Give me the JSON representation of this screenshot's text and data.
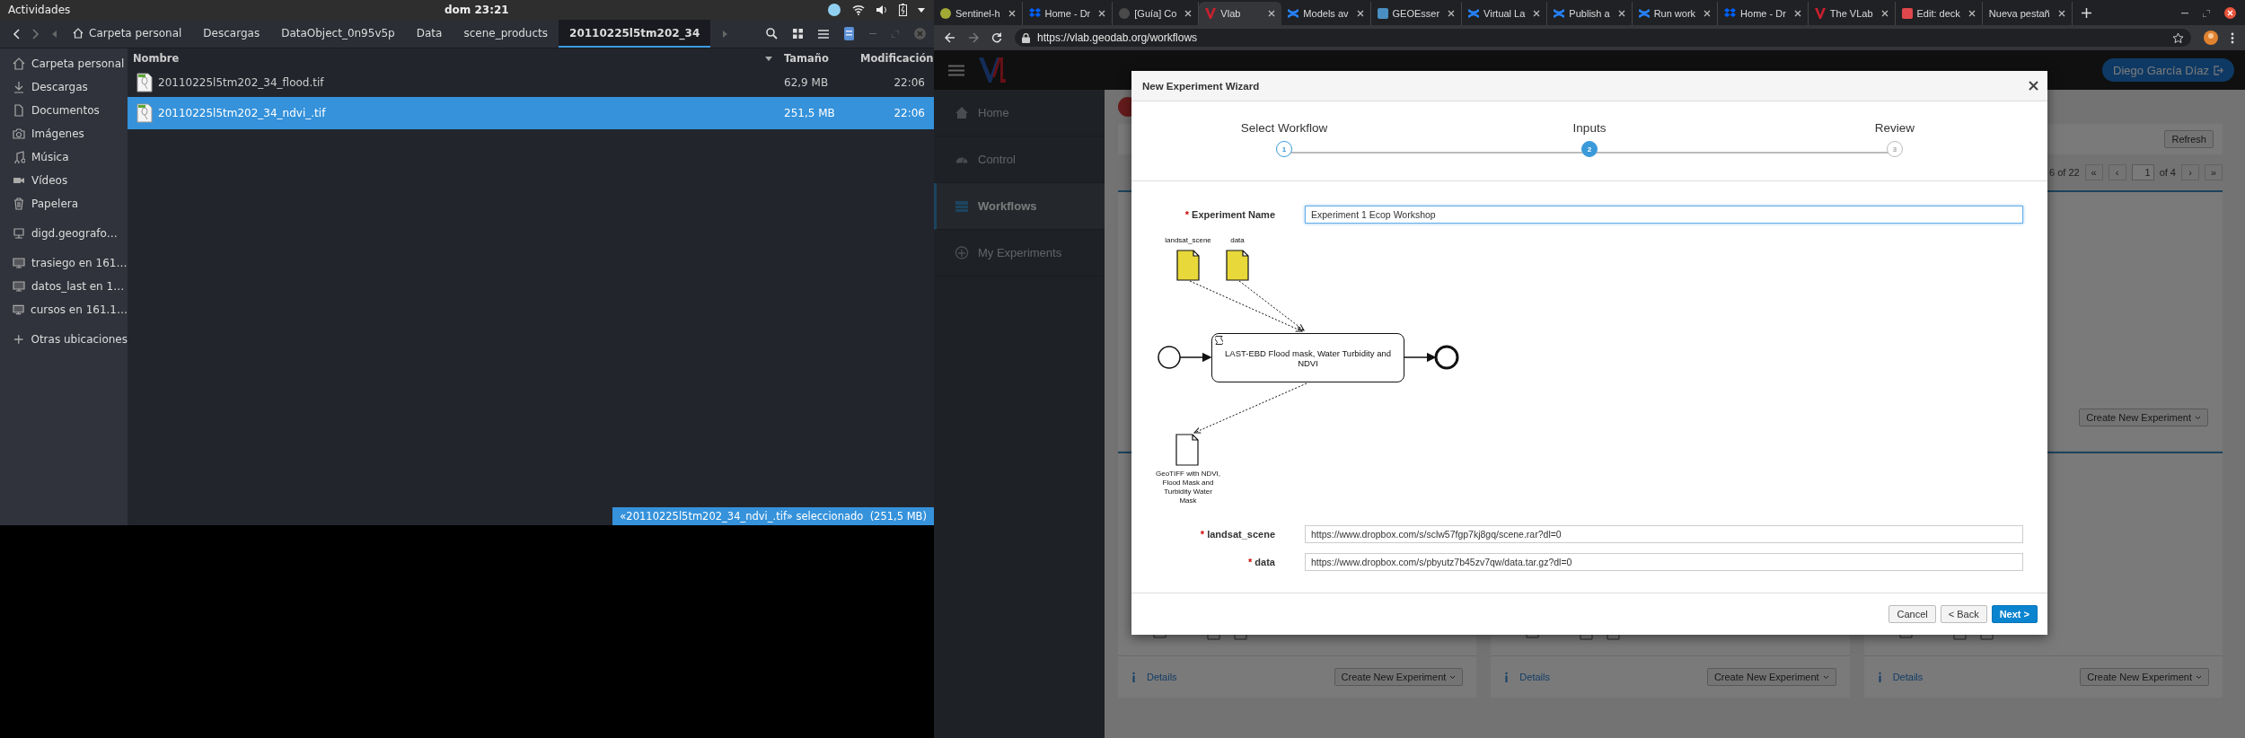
{
  "top_bar": {
    "activities": "Actividades",
    "clock": "dom 23:21"
  },
  "files": {
    "path": [
      {
        "label": "Carpeta personal",
        "kind": "home",
        "selected": false
      },
      {
        "label": "Descargas",
        "kind": "plain",
        "selected": false
      },
      {
        "label": "DataObject_0n95v5p",
        "kind": "plain",
        "selected": false
      },
      {
        "label": "Data",
        "kind": "plain",
        "selected": false
      },
      {
        "label": "scene_products",
        "kind": "plain",
        "selected": false
      },
      {
        "label": "20110225l5tm202_34",
        "kind": "plain",
        "selected": true
      }
    ],
    "sidebar_groups": [
      {
        "items": [
          {
            "label": "Carpeta personal",
            "kind": "home"
          },
          {
            "label": "Descargas",
            "kind": "download"
          },
          {
            "label": "Documentos",
            "kind": "document"
          },
          {
            "label": "Imágenes",
            "kind": "camera"
          },
          {
            "label": "Música",
            "kind": "music"
          },
          {
            "label": "Vídeos",
            "kind": "video"
          },
          {
            "label": "Papelera",
            "kind": "trash"
          }
        ]
      },
      {
        "items": [
          {
            "label": "digd.geografo…",
            "kind": "drive"
          }
        ]
      },
      {
        "items": [
          {
            "label": "trasiego en 161…",
            "kind": "network"
          },
          {
            "label": "datos_last en 1…",
            "kind": "network"
          },
          {
            "label": "cursos en 161.1…",
            "kind": "network"
          }
        ]
      },
      {
        "items": [
          {
            "label": "Otras ubicaciones",
            "kind": "add"
          }
        ]
      }
    ],
    "columns": [
      "Nombre",
      "Tamaño",
      "Modificación"
    ],
    "rows": [
      {
        "name": "20110225l5tm202_34_flood.tif",
        "size": "62,9 MB",
        "modified": "22:06",
        "selected": false
      },
      {
        "name": "20110225l5tm202_34_ndvi_.tif",
        "size": "251,5 MB",
        "modified": "22:06",
        "selected": true
      }
    ],
    "status": "«20110225l5tm202_34_ndvi_.tif» seleccionado  (251,5 MB)"
  },
  "browser": {
    "tabs": [
      {
        "title": "Sentinel-h",
        "kind": "dot",
        "color": "#a3a935",
        "selected": false
      },
      {
        "title": "Home - Dr",
        "kind": "box",
        "color": "#0061fe",
        "selected": false
      },
      {
        "title": "[Guía] Co",
        "kind": "dot",
        "color": "#4a4a4a",
        "selected": false
      },
      {
        "title": "Vlab",
        "kind": "vl",
        "color": "#c8202f",
        "selected": true
      },
      {
        "title": "Models av",
        "kind": "x",
        "color": "#2684ff",
        "selected": false
      },
      {
        "title": "GEOEsser",
        "kind": "square",
        "color": "#4a8fc1",
        "selected": false
      },
      {
        "title": "Virtual La",
        "kind": "x",
        "color": "#2684ff",
        "selected": false
      },
      {
        "title": "Publish a",
        "kind": "x",
        "color": "#2684ff",
        "selected": false
      },
      {
        "title": "Run work",
        "kind": "x",
        "color": "#2684ff",
        "selected": false
      },
      {
        "title": "Home - Dr",
        "kind": "box",
        "color": "#0061fe",
        "selected": false
      },
      {
        "title": "The VLab",
        "kind": "vl",
        "color": "#c8202f",
        "selected": false
      },
      {
        "title": "Edit: deck",
        "kind": "square",
        "color": "#e0474c",
        "selected": false
      },
      {
        "title": "Nueva pestañ",
        "kind": "none",
        "selected": false
      }
    ],
    "url": "https://vlab.geodab.org/workflows"
  },
  "vlab": {
    "user": "Diego García Díaz",
    "nav": [
      {
        "label": "Home",
        "kind": "home",
        "selected": false
      },
      {
        "label": "Control",
        "kind": "gauge",
        "selected": false
      },
      {
        "label": "Workflows",
        "kind": "stack",
        "selected": true
      },
      {
        "label": "My Experiments",
        "kind": "plus",
        "selected": false
      }
    ],
    "refresh": "Refresh",
    "pager": {
      "range": "6 of 22",
      "first": "«",
      "prev": "‹",
      "page": "1",
      "of": "of 4",
      "next": "›",
      "last": "»"
    },
    "top_card_button": "Create New Experiment",
    "cards": [
      {
        "details": "Details",
        "button": "Create New Experiment"
      },
      {
        "details": "Details",
        "button": "Create New Experiment"
      },
      {
        "details": "Details",
        "button": "Create New Experiment"
      }
    ]
  },
  "wizard": {
    "title": "New Experiment Wizard",
    "steps": [
      {
        "label": "Select Workflow",
        "number": "1",
        "done": true,
        "selected": false
      },
      {
        "label": "Inputs",
        "number": "2",
        "done": false,
        "selected": true
      },
      {
        "label": "Review",
        "number": "3",
        "done": false,
        "selected": false
      }
    ],
    "name_field": {
      "mark": "*",
      "label": "Experiment Name",
      "value": "Experiment 1 Ecop Workshop",
      "focused": true
    },
    "diagram": {
      "inputs": [
        "landsat_scene",
        "data"
      ],
      "task": "LAST-EBD Flood mask, Water Turbidity and NDVI",
      "output": "GeoTIFF with NDVI, Flood Mask and Turbidity Water Mask"
    },
    "fields": [
      {
        "mark": "*",
        "label": "landsat_scene",
        "value": "https://www.dropbox.com/s/sclw57fgp7kj8gq/scene.rar?dl=0"
      },
      {
        "mark": "*",
        "label": "data",
        "value": "https://www.dropbox.com/s/pbyutz7b45zv7qw/data.tar.gz?dl=0"
      }
    ],
    "buttons": [
      {
        "label": "Cancel",
        "kind": "default"
      },
      {
        "label": "< Back",
        "kind": "default"
      },
      {
        "label": "Next >",
        "kind": "primary"
      }
    ]
  }
}
